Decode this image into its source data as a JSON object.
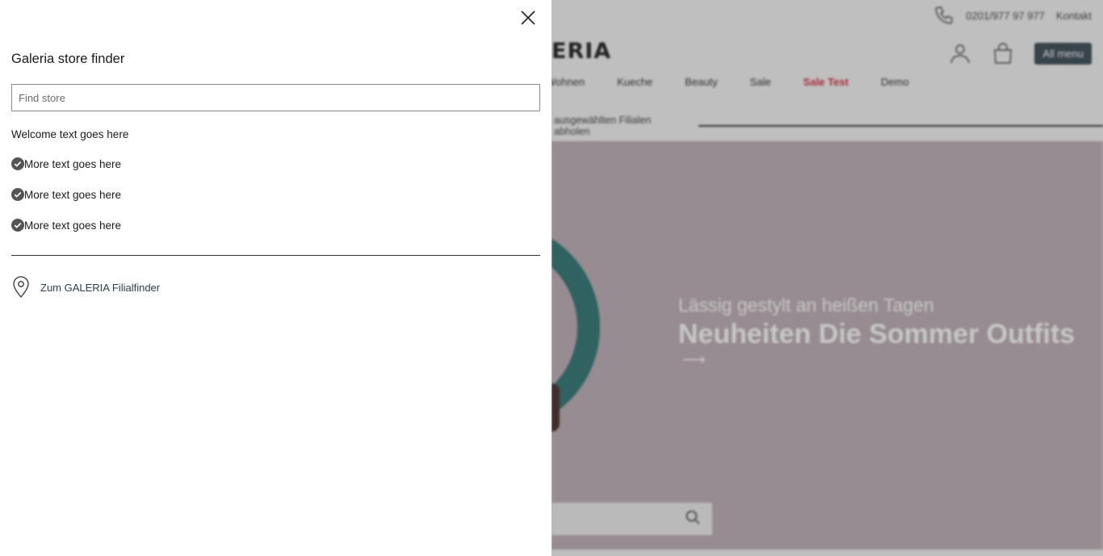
{
  "top_bar": {
    "phone": "0201/977 97 977",
    "contact": "Kontakt"
  },
  "header": {
    "logo_text": "ERIA",
    "menu_button": "All menu"
  },
  "nav": {
    "items": [
      "Wohnen",
      "Kueche",
      "Beauty",
      "Sale",
      "Sale Test",
      "Demo"
    ],
    "highlighted": "Sale Test"
  },
  "promo": {
    "text": "ausgewählten Filialen abholen"
  },
  "hero": {
    "subtitle": "Lässig gestylt an heißen Tagen",
    "title": "Neuheiten Die Sommer Outfits",
    "arrow": "⟶"
  },
  "drawer": {
    "title": "Galeria store finder",
    "search_placeholder": "Find store",
    "welcome": "Welcome text goes here",
    "features": [
      "More text goes here",
      "More text goes here",
      "More text goes here"
    ],
    "finder_link": "Zum GALERIA Filialfinder"
  },
  "colors": {
    "accent": "#2c3e48",
    "sale": "#d31c2c",
    "teal": "#1f6b68",
    "hero_bg": "#b9a8b0",
    "check": "#555555"
  },
  "icons": [
    "close-icon",
    "check-circle-icon",
    "location-pin-icon",
    "phone-icon",
    "user-icon",
    "shopping-bag-icon",
    "search-icon"
  ]
}
